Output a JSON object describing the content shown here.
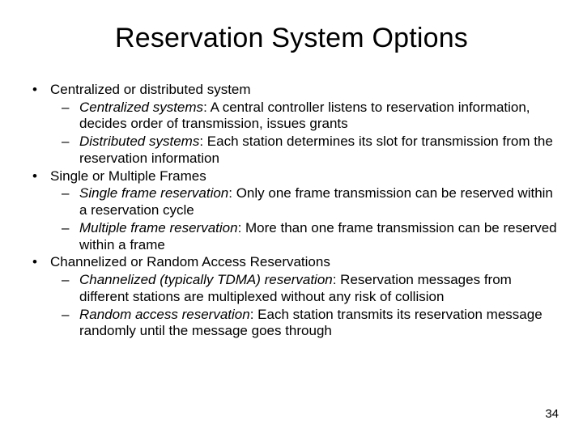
{
  "title": "Reservation System Options",
  "bullets": [
    {
      "text": "Centralized or distributed system",
      "children": [
        {
          "term": "Centralized systems",
          "desc": ": A central controller listens to reservation information, decides order of transmission, issues grants"
        },
        {
          "term": "Distributed systems",
          "desc": ": Each station determines its slot for transmission from the reservation information"
        }
      ]
    },
    {
      "text": "Single or Multiple Frames",
      "children": [
        {
          "term": "Single frame reservation",
          "desc": ": Only one frame transmission can be reserved within a reservation cycle"
        },
        {
          "term": "Multiple frame reservation",
          "desc": ": More than one frame transmission can be reserved within a frame"
        }
      ]
    },
    {
      "text": "Channelized or Random Access Reservations",
      "children": [
        {
          "term": "Channelized (typically TDMA) reservation",
          "desc": ": Reservation messages from different stations are multiplexed without any risk of collision"
        },
        {
          "term": "Random access reservation",
          "desc": ": Each station transmits its reservation message randomly until the message goes through"
        }
      ]
    }
  ],
  "page_number": "34"
}
